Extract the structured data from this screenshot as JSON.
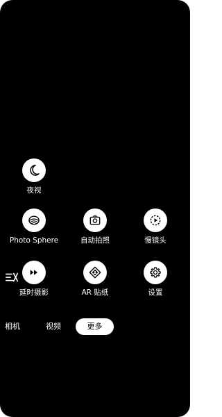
{
  "modes": {
    "night": {
      "label": "夜视",
      "icon": "moon-icon"
    },
    "photo_sphere": {
      "label": "Photo Sphere",
      "icon": "sphere-icon"
    },
    "auto_capture": {
      "label": "自动拍照",
      "icon": "auto-capture-icon"
    },
    "slow_motion": {
      "label": "慢镜头",
      "icon": "slow-motion-icon"
    },
    "time_lapse": {
      "label": "延时摄影",
      "icon": "fast-forward-icon"
    },
    "ar_stickers": {
      "label": "AR 贴纸",
      "icon": "ar-sticker-icon"
    },
    "settings": {
      "label": "设置",
      "icon": "gear-icon"
    }
  },
  "side_toggle": {
    "icon": "sort-off-icon"
  },
  "tabs": [
    {
      "label": "相机",
      "active": false
    },
    {
      "label": "视频",
      "active": false
    },
    {
      "label": "更多",
      "active": true
    }
  ],
  "colors": {
    "background": "#000000",
    "button": "#ffffff",
    "text": "#ffffff",
    "active_tab_bg": "#ffffff",
    "active_tab_text": "#000000"
  }
}
